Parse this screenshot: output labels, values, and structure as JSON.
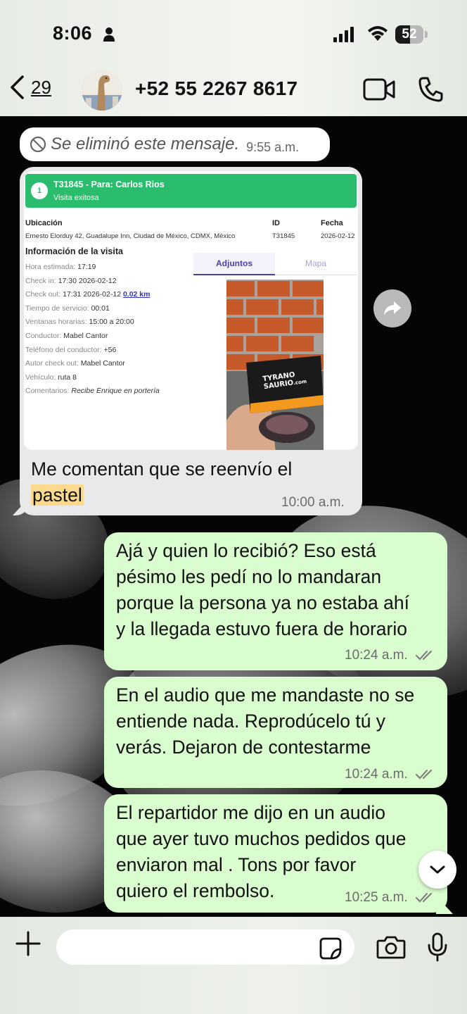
{
  "status_bar": {
    "time": "8:06",
    "battery_percent": "52",
    "battery_level": 0.52
  },
  "header": {
    "back_count": "29",
    "contact_name": "+52 55 2267 8617"
  },
  "messages": {
    "deleted": {
      "text": "Se eliminó este mensaje.",
      "time": "9:55 a.m."
    },
    "card": {
      "caption_before": "Me comentan que se reenvío el",
      "caption_highlight": "pastel",
      "time": "10:00 a.m.",
      "report": {
        "number": "1",
        "title": "T31845 - Para: Carlos Rios",
        "subtitle": "Visita exitosa",
        "location_label": "Ubicación",
        "location_value": "Ernesto Elorduy 42, Guadalupe Inn, Ciudad de México, CDMX, México",
        "id_label": "ID",
        "id_value": "T31845",
        "date_label": "Fecha",
        "date_value": "2026-02-12",
        "section_title": "Información de la visita",
        "rows": [
          {
            "label": "Hora estimada:",
            "value": "17:19"
          },
          {
            "label": "Check in:",
            "value": "17:30 2026-02-12"
          },
          {
            "label": "Check out:",
            "value": "17:31 2026-02-12",
            "link": "0.02 km"
          },
          {
            "label": "Tiempo de servicio:",
            "value": "00:01"
          },
          {
            "label": "Ventanas horarias:",
            "value": "15:00 a 20:00"
          },
          {
            "label": "Conductor:",
            "value": "Mabel Cantor"
          },
          {
            "label": "Teléfono del conductor:",
            "value": "+56"
          },
          {
            "label": "Autor check out:",
            "value": "Mabel Cantor"
          },
          {
            "label": "Vehículo:",
            "value": "ruta 8"
          },
          {
            "label": "Comentarios:",
            "value": "Recibe Enrique en portería"
          }
        ],
        "tab_attachments": "Adjuntos",
        "tab_map": "Mapa",
        "photo_brand_line1": "TYRANO",
        "photo_brand_line2": "SAURIO",
        "photo_brand_suffix": ".com"
      }
    },
    "out1": {
      "text": "Ajá y quien lo recibió? Eso está pésimo les pedí no lo mandaran porque la persona ya no estaba ahí y la llegada estuvo fuera de horario",
      "lines": [
        "Ajá y quien lo recibió? Eso está",
        "pésimo les pedí no lo mandaran",
        "porque la persona ya no estaba ahí",
        "y la llegada estuvo fuera de horario"
      ],
      "time": "10:24 a.m."
    },
    "out2": {
      "lines": [
        "En el audio que me mandaste no se",
        "entiende nada. Reprodúcelo tú y",
        "verás. Dejaron de contestarme"
      ],
      "time": "10:24 a.m."
    },
    "out3": {
      "lines": [
        "El repartidor me dijo en un audio",
        "que ayer tuvo muchos pedidos que",
        "enviaron mal . Tons por favor",
        "quiero el rembolso."
      ],
      "time": "10:25 a.m."
    }
  },
  "input": {
    "placeholder": "",
    "value": ""
  },
  "colors": {
    "outgoing_bubble": "#dafdcf",
    "incoming_bubble": "#e9e9eb",
    "report_header": "#2bbd6e",
    "highlight": "#fbd98f",
    "tab_accent": "#4a3fa8"
  }
}
